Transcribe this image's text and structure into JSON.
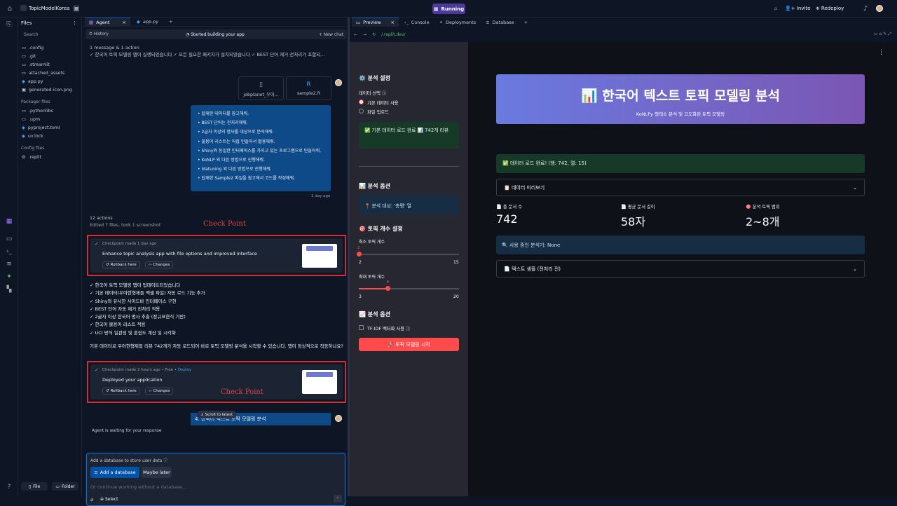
{
  "topbar": {
    "project": "TopicModelKorea",
    "status": "Running",
    "invite": "Invite",
    "redeploy": "Redeploy"
  },
  "files": {
    "title": "Files",
    "search": "Search",
    "items": [
      ".config",
      ".git",
      ".streamlit",
      "attached_assets",
      "app.py",
      "generated-icon.png"
    ],
    "packager_title": "Packager files",
    "packager": [
      ".pythonlibs",
      ".upm",
      "pyproject.toml",
      "uv.lock"
    ],
    "config_title": "Config files",
    "config": [
      ".replit"
    ],
    "file_btn": "File",
    "folder_btn": "Folder"
  },
  "agent": {
    "tab": "Agent",
    "tab2": "app.py",
    "history": "History",
    "status": "Started building your app",
    "new_chat": "New chat",
    "msg_count": "1 message & 1 action",
    "msg_preview": "✓ 한국어 토픽 모델링 앱이 실행되었습니다 ✓ 모든 필요한 패키지가 설치되었습니다 ✓ BEST 단어 제거 전처리가 포함되...",
    "file1": "jobplanet_우아...",
    "file2": "sample2.R",
    "bullets": [
      "탑재한 데이터를 참고해줘.",
      "BEST 단어는 전처리해줘.",
      "2글자 이상의 명사를 대상으로 분석해줘.",
      "불용어 리스트는 직접 만들어서 활용해줘.",
      "Shiny와 동일한 인터페이스를 가지고 있는 프로그램으로 만들어줘.",
      "KoNLP 외 다른 방법으로 진행해줘.",
      "ldatuning 외 다른 방법으로 진행해줘.",
      "탑재한 Sample2 파일을 참고해서 코드를 작성해줘."
    ],
    "msg_time": "1 day ago",
    "actions": "12 actions",
    "actions_sub": "Edited 7 files, took 1 screenshot",
    "ck_label": "Check Point",
    "ck1": {
      "meta": "Checkpoint made 1 day ago",
      "msg": "Enhance topic analysis app with file options and improved interface",
      "rollback": "Rollback here",
      "changes": "Changes"
    },
    "summary": [
      "✓ 한국어 토픽 모델링 앱이 업데이트되었습니다",
      "✓ 기본 데이터(우아한형제들 엑셀 파일) 자동 로드 기능 추가",
      "✓ Shiny와 유사한 사이드바 인터페이스 구현",
      "✓ BEST 단어 자동 제거 전처리 적용",
      "✓ 2글자 이상 한국어 명사 추출 (정규표현식 기반)",
      "✓ 한국어 불용어 리스트 적용",
      "✓ UCI 방식 일관성 및 혼잡도 계산 및 시각화"
    ],
    "question": "기본 데이터로 우아한형제들 리뷰 742개가 자동 로드되어 바로 토픽 모델링 분석을 시작할 수 있습니다. 앱이 정상적으로 작동하나요?",
    "ck2": {
      "meta": "Checkpoint made 2 hours ago",
      "free": "Free",
      "deploy": "Deploy",
      "msg": "Deployed your application",
      "rollback": "Rollback here",
      "changes": "Changes"
    },
    "scroll": "Scroll to latest",
    "partial": "4. 한국어 텍스트 토픽 모델링 분석",
    "waiting": "Agent is waiting for your response",
    "db_prompt": "Add a database to store user data",
    "add_db": "Add a database",
    "maybe": "Maybe later",
    "placeholder": "Or continue working without a database...",
    "select": "Select"
  },
  "preview": {
    "tabs": [
      "Preview",
      "Console",
      "Deployments",
      "Database"
    ],
    "url": "/.replit.dev/"
  },
  "app": {
    "settings_title": "⚙️ 분석 설정",
    "data_select": "데이터 선택",
    "opt1": "기본 데이터 사용",
    "opt2": "파일 업로드",
    "load_ok": "✅ 기본 데이터 로드 완료 📊 742개 리뷰",
    "options_title": "📊 분석 옵션",
    "target": "📍 분석 대상: '총평' 열",
    "topic_title": "🎯 토픽 개수 설정",
    "min_label": "최소 토픽 개수",
    "min_val": "2",
    "min_lo": "2",
    "min_hi": "15",
    "max_label": "최대 토픽 개수",
    "max_val": "8",
    "max_lo": "3",
    "max_hi": "20",
    "min_frac": 0.0,
    "max_frac": 0.29,
    "advanced_title": "📈 분석 옵션",
    "tfidf": "TF-IDF 벡터화 사용",
    "start": "🚀 토픽 모델링 시작",
    "banner_title": "📊 한국어 텍스트 토픽 모델링 분석",
    "banner_sub": "KoNLPy 형태소 분석 및 고도화된 토픽 모델링",
    "data_ok": "✅ 데이터 로드 완료! (행: 742, 열: 15)",
    "preview_exp": "📋 데이터 미리보기",
    "m1_label": "📄 총 문서 수",
    "m1_val": "742",
    "m2_label": "📄 평균 문서 길이",
    "m2_val": "58자",
    "m3_label": "🎯 분석 토픽 범위",
    "m3_val": "2~8개",
    "analyzer": "🔍 사용 중인 분석기: None",
    "sample_exp": "📄 텍스트 샘플 (전처리 전)"
  }
}
